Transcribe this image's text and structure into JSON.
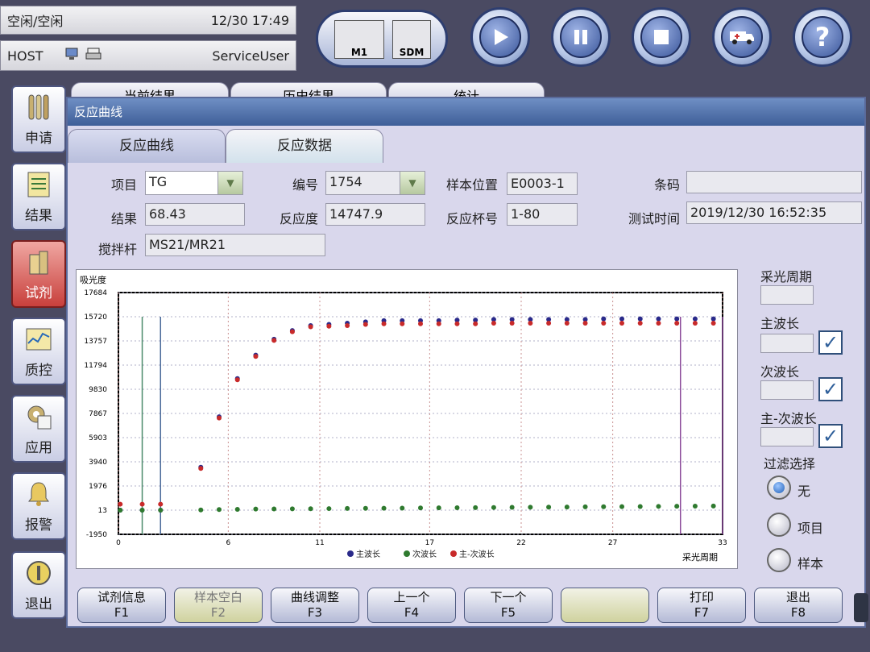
{
  "status": {
    "state": "空闲/空闲",
    "datetime": "12/30 17:49",
    "host": "HOST",
    "user": "ServiceUser"
  },
  "module_panel": {
    "m1": "M1",
    "sdm": "SDM"
  },
  "toolbar_icons": [
    "play-icon",
    "pause-icon",
    "stop-icon",
    "ambulance-icon",
    "help-icon"
  ],
  "nav": {
    "items": [
      {
        "label": "申请",
        "icon": "tubes-icon"
      },
      {
        "label": "结果",
        "icon": "results-sheet-icon"
      },
      {
        "label": "试剂",
        "icon": "reagent-bottle-icon"
      },
      {
        "label": "质控",
        "icon": "qc-chart-icon"
      },
      {
        "label": "应用",
        "icon": "settings-icon"
      },
      {
        "label": "报警",
        "icon": "bell-icon"
      },
      {
        "label": "退出",
        "icon": "exit-icon"
      }
    ]
  },
  "back_tabs": [
    "当前结果",
    "历史结果",
    "统计"
  ],
  "dialog": {
    "title": "反应曲线",
    "tabs": [
      "反应曲线",
      "反应数据"
    ],
    "fields": {
      "item_label": "项目",
      "item_value": "TG",
      "number_label": "编号",
      "number_value": "1754",
      "position_label": "样本位置",
      "position_value": "E0003-1",
      "barcode_label": "条码",
      "barcode_value": "",
      "result_label": "结果",
      "result_value": "68.43",
      "reactivity_label": "反应度",
      "reactivity_value": "14747.9",
      "cup_label": "反应杯号",
      "cup_value": "1-80",
      "time_label": "测试时间",
      "time_value": "2019/12/30 16:52:35",
      "stirrer_label": "搅拌杆",
      "stirrer_value": "MS21/MR21"
    },
    "side": {
      "period_label": "采光周期",
      "main_label": "主波长",
      "sub_label": "次波长",
      "diff_label": "主-次波长",
      "filter_label": "过滤选择",
      "radios": [
        {
          "label": "无",
          "selected": true
        },
        {
          "label": "项目",
          "selected": false
        },
        {
          "label": "样本",
          "selected": false
        }
      ],
      "checked_mark": "✓"
    },
    "fkeys": [
      {
        "label": "试剂信息",
        "key": "F1",
        "enabled": true
      },
      {
        "label": "样本空白",
        "key": "F2",
        "enabled": false
      },
      {
        "label": "曲线调整",
        "key": "F3",
        "enabled": true
      },
      {
        "label": "上一个",
        "key": "F4",
        "enabled": true
      },
      {
        "label": "下一个",
        "key": "F5",
        "enabled": true
      },
      {
        "label": "",
        "key": "",
        "enabled": false
      },
      {
        "label": "打印",
        "key": "F7",
        "enabled": true
      },
      {
        "label": "退出",
        "key": "F8",
        "enabled": true
      }
    ]
  },
  "chart_data": {
    "type": "scatter",
    "ylabel": "吸光度",
    "xlabel": "采光周期",
    "x_ticks": [
      0,
      6,
      11,
      17,
      22,
      27,
      33
    ],
    "y_ticks": [
      -1950,
      13,
      1976,
      3940,
      5903,
      7867,
      9830,
      11794,
      13757,
      15720,
      17684
    ],
    "xlim": [
      0,
      33
    ],
    "ylim": [
      -1950,
      17684
    ],
    "grid": true,
    "legend_position": "bottom",
    "vertical_markers": [
      {
        "x": 1.3,
        "color": "#4a8a6a"
      },
      {
        "x": 2.3,
        "color": "#4a6a9a"
      },
      {
        "x": 30.7,
        "color": "#8a4a9a"
      },
      {
        "x": 33,
        "color": "#8a4a9a"
      }
    ],
    "series": [
      {
        "name": "主波长",
        "color": "#2a2a8a",
        "x": [
          0.1,
          1.3,
          2.3,
          4.5,
          5.5,
          6.5,
          7.5,
          8.5,
          9.5,
          10.5,
          11.5,
          12.5,
          13.5,
          14.5,
          15.5,
          16.5,
          17.5,
          18.5,
          19.5,
          20.5,
          21.5,
          22.5,
          23.5,
          24.5,
          25.5,
          26.5,
          27.5,
          28.5,
          29.5,
          30.5,
          31.5,
          32.5
        ],
        "y": [
          13,
          13,
          13,
          3500,
          7600,
          10700,
          12600,
          13900,
          14600,
          15000,
          15100,
          15200,
          15300,
          15400,
          15400,
          15400,
          15400,
          15450,
          15450,
          15500,
          15500,
          15500,
          15500,
          15500,
          15500,
          15550,
          15550,
          15550,
          15550,
          15550,
          15550,
          15550
        ]
      },
      {
        "name": "次波长",
        "color": "#2f7a2f",
        "x": [
          0.1,
          1.3,
          2.3,
          4.5,
          5.5,
          6.5,
          7.5,
          8.5,
          9.5,
          10.5,
          11.5,
          12.5,
          13.5,
          14.5,
          15.5,
          16.5,
          17.5,
          18.5,
          19.5,
          20.5,
          21.5,
          22.5,
          23.5,
          24.5,
          25.5,
          26.5,
          27.5,
          28.5,
          29.5,
          30.5,
          31.5,
          32.5
        ],
        "y": [
          13,
          13,
          13,
          30,
          60,
          80,
          100,
          110,
          120,
          130,
          140,
          150,
          160,
          170,
          180,
          190,
          200,
          210,
          220,
          230,
          240,
          250,
          260,
          270,
          280,
          290,
          300,
          310,
          320,
          330,
          340,
          350
        ]
      },
      {
        "name": "主-次波长",
        "color": "#c82a2a",
        "x": [
          0.1,
          1.3,
          2.3,
          4.5,
          5.5,
          6.5,
          7.5,
          8.5,
          9.5,
          10.5,
          11.5,
          12.5,
          13.5,
          14.5,
          15.5,
          16.5,
          17.5,
          18.5,
          19.5,
          20.5,
          21.5,
          22.5,
          23.5,
          24.5,
          25.5,
          26.5,
          27.5,
          28.5,
          29.5,
          30.5,
          31.5,
          32.5
        ],
        "y": [
          500,
          500,
          500,
          3400,
          7500,
          10600,
          12500,
          13800,
          14500,
          14900,
          14950,
          15000,
          15100,
          15150,
          15150,
          15150,
          15150,
          15150,
          15150,
          15200,
          15200,
          15200,
          15200,
          15200,
          15200,
          15200,
          15200,
          15200,
          15200,
          15200,
          15200,
          15200
        ]
      }
    ]
  }
}
